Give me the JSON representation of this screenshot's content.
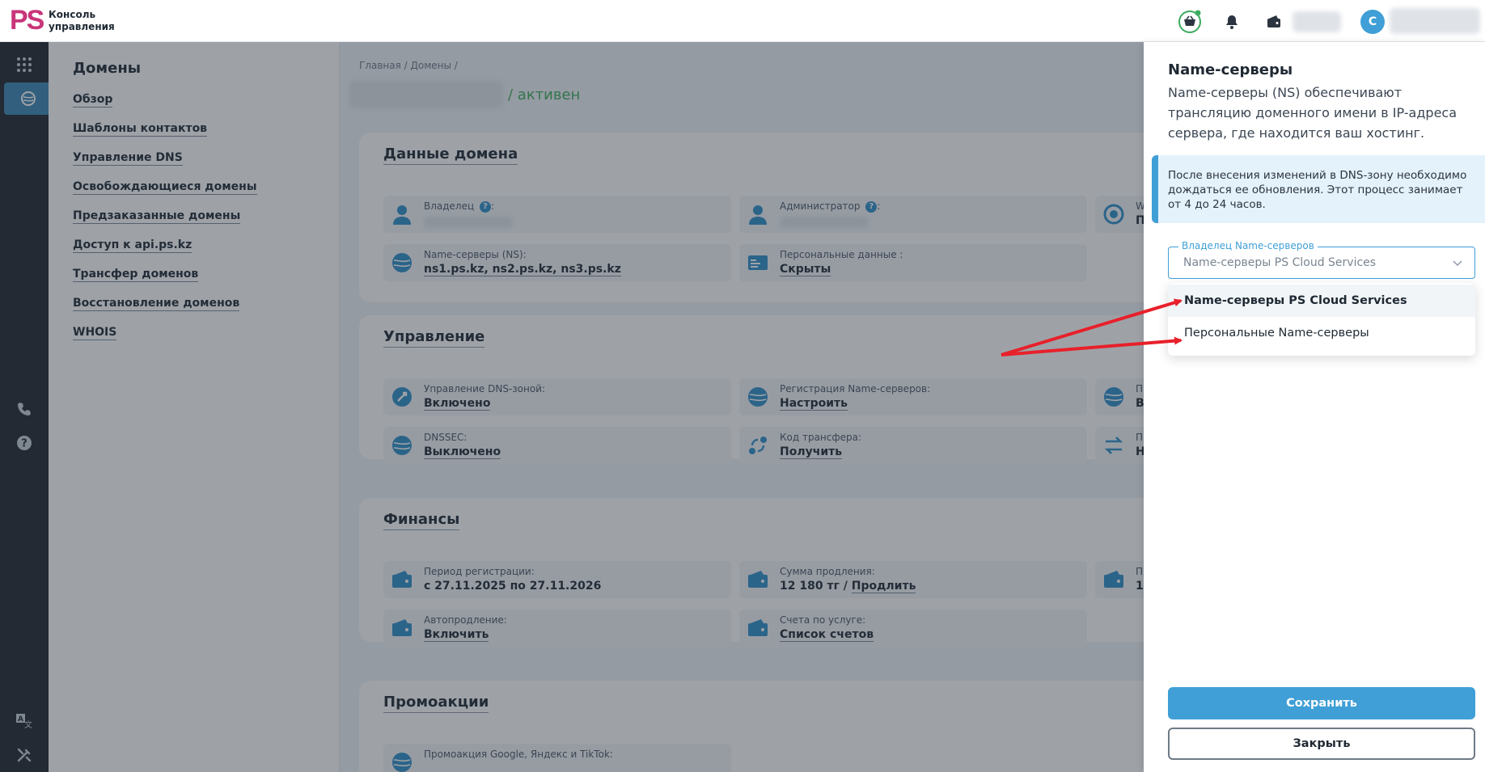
{
  "header": {
    "logo": "PS",
    "console_line1": "Консоль",
    "console_line2": "управления",
    "avatar_letter": "С"
  },
  "subnav": {
    "title": "Домены",
    "items": [
      "Обзор",
      "Шаблоны контактов",
      "Управление DNS",
      "Освобождающиеся домены",
      "Предзаказанные домены",
      "Доступ к api.ps.kz",
      "Трансфер доменов",
      "Восстановление доменов",
      "WHOIS"
    ]
  },
  "main": {
    "breadcrumb": "Главная  /  Домены  /",
    "status": "/ активен",
    "domain_data": {
      "title": "Данные домена",
      "owner_label": "Владелец",
      "admin_label": "Администратор",
      "ns_label": "Name-серверы (NS):",
      "ns_value": "ns1.ps.kz, ns2.ps.kz, ns3.ps.kz",
      "personal_label": "Персональные данные :",
      "personal_value": "Скрыты",
      "cut_label": "W",
      "cut_value": "П"
    },
    "management": {
      "title": "Управление",
      "dns_zone_label": "Управление DNS-зоной:",
      "dns_zone_value": "Включено",
      "ns_reg_label": "Регистрация Name-серверов:",
      "ns_reg_value": "Настроить",
      "dnssec_label": "DNSSEC:",
      "dnssec_value": "Выключено",
      "transfer_label": "Код трансфера:",
      "transfer_value": "Получить",
      "cut1_label": "П",
      "cut1_value": "В",
      "cut2_label": "П",
      "cut2_value": "Н"
    },
    "finance": {
      "title": "Финансы",
      "period_label": "Период регистрации:",
      "period_value": "с 27.11.2025 по 27.11.2026",
      "renew_sum_label": "Сумма продления:",
      "renew_sum_value": "12 180 тг /",
      "renew_link": "Продлить",
      "autorenew_label": "Автопродление:",
      "autorenew_value": "Включить",
      "invoices_label": "Счета по услуге:",
      "invoices_value": "Список счетов",
      "cut_label": "П",
      "cut_value": "1"
    },
    "promo": {
      "title": "Промоакции",
      "item_label": "Промоакция Google, Яндекс и TikTok:"
    }
  },
  "panel": {
    "title": "Name-серверы",
    "description": "Name-серверы (NS) обеспечивают трансляцию доменного имени в IP-адреса сервера, где находится ваш хостинг.",
    "info": "После внесения изменений в DNS-зону необходимо дождаться ее обновления. Этот процесс занимает от 4 до 24 часов.",
    "select_label": "Владелец Name-серверов",
    "select_value": "Name-серверы PS Cloud Services",
    "options": [
      "Name-серверы PS Cloud Services",
      "Персональные Name-серверы"
    ],
    "save_label": "Сохранить",
    "close_label": "Закрыть"
  },
  "colors": {
    "accent": "#3f9fd6",
    "brand": "#c8357a",
    "status_active": "#3cab5e",
    "annotation_arrow": "#e8202a"
  }
}
